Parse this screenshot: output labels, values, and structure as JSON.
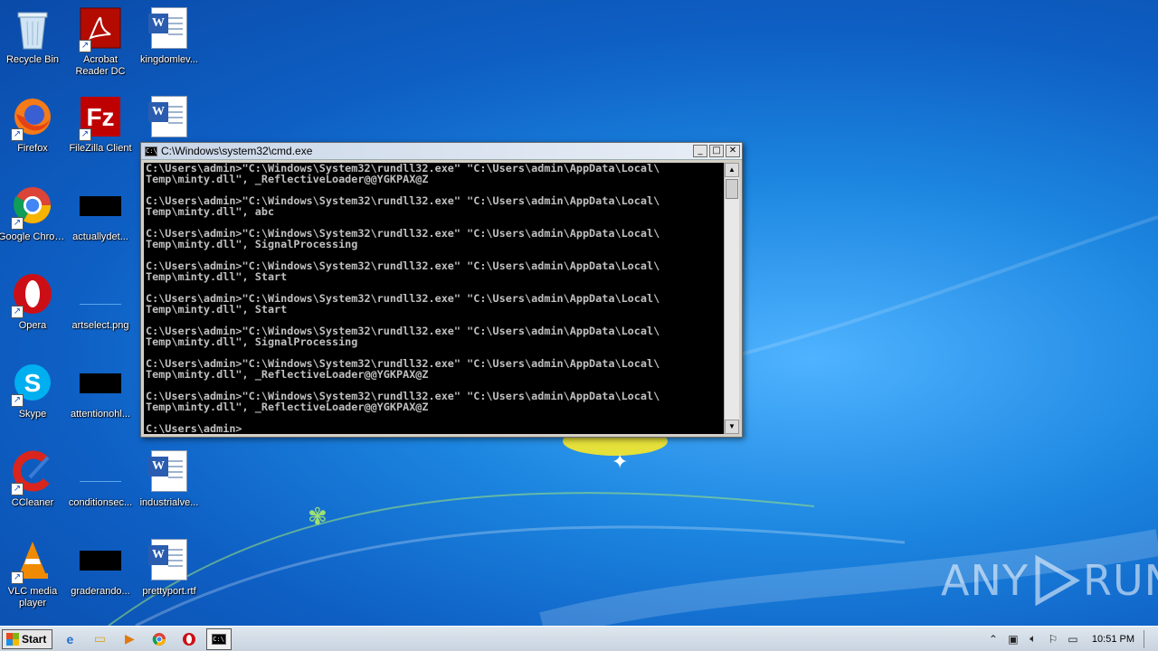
{
  "desktop": {
    "icons": [
      {
        "label": "Recycle Bin",
        "icon": "recycle-bin-icon"
      },
      {
        "label": "Acrobat Reader DC",
        "icon": "acrobat-icon"
      },
      {
        "label": "kingdomlev...",
        "icon": "word-document-icon"
      },
      {
        "label": "Firefox",
        "icon": "firefox-icon"
      },
      {
        "label": "FileZilla Client",
        "icon": "filezilla-icon"
      },
      {
        "label": "",
        "icon": "word-document-icon"
      },
      {
        "label": "Google Chrome",
        "icon": "chrome-icon"
      },
      {
        "label": "actuallydet...",
        "icon": "black-thumbnail"
      },
      {
        "label": "Opera",
        "icon": "opera-icon"
      },
      {
        "label": "artselect.png",
        "icon": "image-thumbnail"
      },
      {
        "label": "Skype",
        "icon": "skype-icon"
      },
      {
        "label": "attentionohl...",
        "icon": "black-thumbnail"
      },
      {
        "label": "CCleaner",
        "icon": "ccleaner-icon"
      },
      {
        "label": "conditionsec...",
        "icon": "image-thumbnail"
      },
      {
        "label": "industrialve...",
        "icon": "word-document-icon"
      },
      {
        "label": "VLC media player",
        "icon": "vlc-icon"
      },
      {
        "label": "graderando...",
        "icon": "black-thumbnail"
      },
      {
        "label": "prettyport.rtf",
        "icon": "word-document-icon"
      }
    ]
  },
  "cmd": {
    "title": "C:\\Windows\\system32\\cmd.exe",
    "minimize": "_",
    "maximize": "□",
    "close": "✕",
    "output": "C:\\Users\\admin>\"C:\\Windows\\System32\\rundll32.exe\" \"C:\\Users\\admin\\AppData\\Local\\\nTemp\\minty.dll\", _ReflectiveLoader@@YGKPAX@Z\n\nC:\\Users\\admin>\"C:\\Windows\\System32\\rundll32.exe\" \"C:\\Users\\admin\\AppData\\Local\\\nTemp\\minty.dll\", abc\n\nC:\\Users\\admin>\"C:\\Windows\\System32\\rundll32.exe\" \"C:\\Users\\admin\\AppData\\Local\\\nTemp\\minty.dll\", SignalProcessing\n\nC:\\Users\\admin>\"C:\\Windows\\System32\\rundll32.exe\" \"C:\\Users\\admin\\AppData\\Local\\\nTemp\\minty.dll\", Start\n\nC:\\Users\\admin>\"C:\\Windows\\System32\\rundll32.exe\" \"C:\\Users\\admin\\AppData\\Local\\\nTemp\\minty.dll\", Start\n\nC:\\Users\\admin>\"C:\\Windows\\System32\\rundll32.exe\" \"C:\\Users\\admin\\AppData\\Local\\\nTemp\\minty.dll\", SignalProcessing\n\nC:\\Users\\admin>\"C:\\Windows\\System32\\rundll32.exe\" \"C:\\Users\\admin\\AppData\\Local\\\nTemp\\minty.dll\", _ReflectiveLoader@@YGKPAX@Z\n\nC:\\Users\\admin>\"C:\\Windows\\System32\\rundll32.exe\" \"C:\\Users\\admin\\AppData\\Local\\\nTemp\\minty.dll\", _ReflectiveLoader@@YGKPAX@Z\n\nC:\\Users\\admin>"
  },
  "taskbar": {
    "start_label": "Start",
    "items": [
      "internet-explorer-icon",
      "explorer-icon",
      "media-player-icon",
      "chrome-icon",
      "opera-icon",
      "cmd-icon"
    ],
    "clock": "10:51 PM"
  },
  "watermark": {
    "left": "ANY",
    "right": "RUN"
  },
  "colors": {
    "desktop_blue": "#1c86e0",
    "console_bg": "#000000",
    "console_text": "#c0c0c0"
  }
}
